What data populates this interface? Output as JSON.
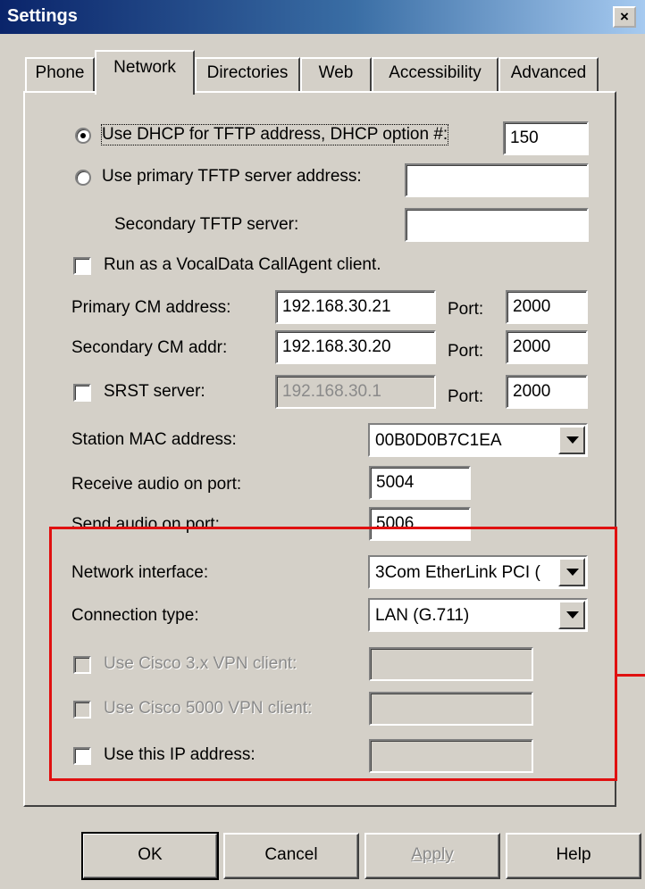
{
  "window": {
    "title": "Settings",
    "close_label": "×"
  },
  "tabs": [
    {
      "label": "Phone",
      "active": false
    },
    {
      "label": "Network",
      "active": true
    },
    {
      "label": "Directories",
      "active": false
    },
    {
      "label": "Web",
      "active": false
    },
    {
      "label": "Accessibility",
      "active": false
    },
    {
      "label": "Advanced",
      "active": false
    }
  ],
  "tftp": {
    "dhcp_label": "Use DHCP for TFTP address, DHCP option #:",
    "dhcp_selected": true,
    "dhcp_option_value": "150",
    "primary_label": "Use primary TFTP server address:",
    "primary_value": "",
    "secondary_label": "Secondary TFTP server:",
    "secondary_value": ""
  },
  "callagent": {
    "label": "Run as a VocalData CallAgent client.",
    "checked": false
  },
  "cm": {
    "primary_label": "Primary CM address:",
    "primary_value": "192.168.30.21",
    "primary_port_label": "Port:",
    "primary_port_value": "2000",
    "secondary_label": "Secondary CM addr:",
    "secondary_value": "192.168.30.20",
    "secondary_port_label": "Port:",
    "secondary_port_value": "2000",
    "srst_label": "SRST server:",
    "srst_checked": false,
    "srst_value": "192.168.30.1",
    "srst_port_label": "Port:",
    "srst_port_value": "2000"
  },
  "station": {
    "mac_label": "Station MAC address:",
    "mac_value": "00B0D0B7C1EA"
  },
  "audio": {
    "receive_label": "Receive audio on port:",
    "receive_value": "5004",
    "send_label": "Send audio on port:",
    "send_value": "5006"
  },
  "network": {
    "interface_label": "Network interface:",
    "interface_value": "3Com EtherLink PCI (",
    "connection_label": "Connection type:",
    "connection_value": "LAN (G.711)",
    "vpn3x_label": "Use Cisco 3.x VPN client:",
    "vpn3x_value": "",
    "vpn5000_label": "Use Cisco 5000 VPN client:",
    "vpn5000_value": "",
    "use_ip_label": "Use this IP address:",
    "use_ip_value": ""
  },
  "buttons": {
    "ok": "OK",
    "cancel": "Cancel",
    "apply": "Apply",
    "help": "Help"
  },
  "colors": {
    "title_bar": "#0a246a",
    "highlight_box": "#e01010",
    "dialog_bg": "#d4d0c8"
  }
}
